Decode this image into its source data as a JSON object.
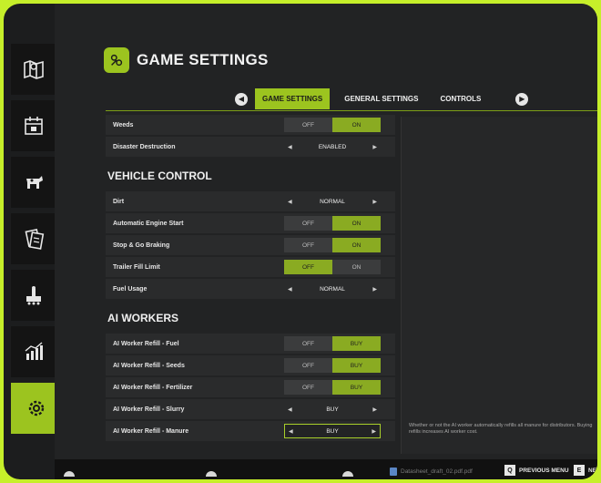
{
  "header": {
    "title": "GAME SETTINGS"
  },
  "tabs": [
    {
      "label": "GAME SETTINGS",
      "active": true
    },
    {
      "label": "GENERAL SETTINGS",
      "active": false
    },
    {
      "label": "CONTROLS",
      "active": false
    }
  ],
  "sidebar": {
    "items": [
      {
        "icon": "map-icon"
      },
      {
        "icon": "calendar-icon"
      },
      {
        "icon": "animals-icon"
      },
      {
        "icon": "contracts-icon"
      },
      {
        "icon": "production-icon"
      },
      {
        "icon": "statistics-icon"
      },
      {
        "icon": "settings-icon",
        "active": true
      }
    ]
  },
  "sections": {
    "vehicle": "VEHICLE CONTROL",
    "ai": "AI WORKERS"
  },
  "rows": {
    "weeds": {
      "label": "Weeds",
      "off": "OFF",
      "on": "ON",
      "selected": "on"
    },
    "disaster": {
      "label": "Disaster Destruction",
      "value": "ENABLED"
    },
    "dirt": {
      "label": "Dirt",
      "value": "NORMAL"
    },
    "engine": {
      "label": "Automatic Engine Start",
      "off": "OFF",
      "on": "ON",
      "selected": "on"
    },
    "stopgo": {
      "label": "Stop & Go Braking",
      "off": "OFF",
      "on": "ON",
      "selected": "on"
    },
    "trailer": {
      "label": "Trailer Fill Limit",
      "off": "OFF",
      "on": "ON",
      "selected": "off"
    },
    "fuel": {
      "label": "Fuel Usage",
      "value": "NORMAL"
    },
    "ai_fuel": {
      "label": "AI Worker Refill - Fuel",
      "off": "OFF",
      "on": "BUY",
      "selected": "on"
    },
    "ai_seeds": {
      "label": "AI Worker Refill - Seeds",
      "off": "OFF",
      "on": "BUY",
      "selected": "on"
    },
    "ai_fert": {
      "label": "AI Worker Refill - Fertilizer",
      "off": "OFF",
      "on": "BUY",
      "selected": "on"
    },
    "ai_slurry": {
      "label": "AI Worker Refill - Slurry",
      "value": "BUY"
    },
    "ai_manure": {
      "label": "AI Worker Refill - Manure",
      "value": "BUY"
    }
  },
  "panel": {
    "description": "Whether or not the AI worker automatically refills all manure for distributors. Buying refills increases AI worker cost."
  },
  "bottom": {
    "prev_key": "Q",
    "prev_label": "PREVIOUS MENU",
    "next_key": "E",
    "next_label": "NE",
    "taskbar_file": "Datasheet_draft_02.pdf.pdf"
  },
  "colors": {
    "accent": "#9cc41f",
    "frame": "#c6ef2a"
  }
}
